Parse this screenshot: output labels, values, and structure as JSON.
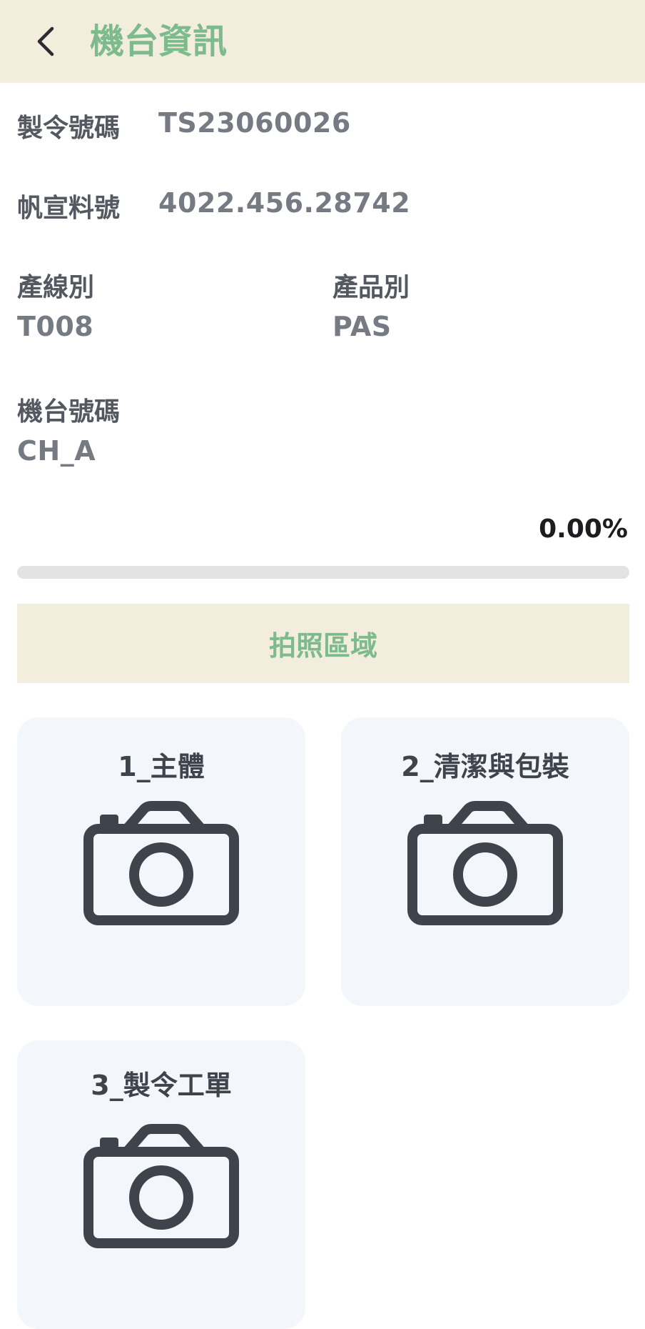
{
  "header": {
    "title": "機台資訊",
    "back_icon": "chevron-left-icon"
  },
  "info": {
    "order_no": {
      "label": "製令號碼",
      "value": "TS23060026"
    },
    "part_no": {
      "label": "帆宣料號",
      "value": "4022.456.28742"
    },
    "line": {
      "label": "產線別",
      "value": "T008"
    },
    "product": {
      "label": "產品別",
      "value": "PAS"
    },
    "machine": {
      "label": "機台號碼",
      "value": "CH_A"
    }
  },
  "progress": {
    "text": "0.00%",
    "value": 0
  },
  "photo_zone": {
    "label": "拍照區域"
  },
  "photo_cards": [
    {
      "title": "1_主體",
      "icon": "camera-icon"
    },
    {
      "title": "2_清潔與包裝",
      "icon": "camera-icon"
    },
    {
      "title": "3_製令工單",
      "icon": "camera-icon"
    }
  ],
  "colors": {
    "accent_green": "#7dba8c",
    "header_bg": "#f2eddd",
    "card_bg": "#f3f6fa",
    "icon_dark": "#3f434b"
  }
}
